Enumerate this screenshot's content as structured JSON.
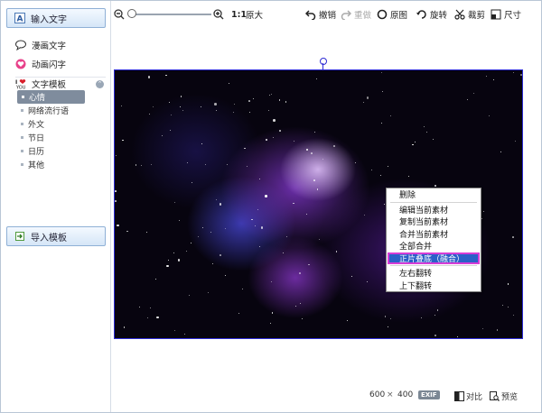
{
  "sidebar": {
    "input_text": "输入文字",
    "comic_text": "漫画文字",
    "anim_text": "动画闪字",
    "template": {
      "title": "文字模板",
      "items": [
        "心情",
        "网络流行语",
        "外文",
        "节日",
        "日历",
        "其他"
      ],
      "selected_index": 0
    },
    "import_template": "导入模板"
  },
  "toolbar": {
    "zoom_fit": "1:1",
    "original_size": "原大",
    "undo": "撤销",
    "redo": "重做",
    "original_image": "原图",
    "rotate": "旋转",
    "crop": "裁剪",
    "size": "尺寸",
    "zoom_level": 0.0
  },
  "context_menu": {
    "items": [
      {
        "label": "删除",
        "sep_after": true
      },
      {
        "label": "编辑当前素材",
        "sep_after": false
      },
      {
        "label": "复制当前素材",
        "sep_after": false
      },
      {
        "label": "合并当前素材",
        "sep_after": false
      },
      {
        "label": "全部合并",
        "sep_after": false
      },
      {
        "label": "正片叠底（融合）",
        "sep_after": true,
        "highlighted": true
      },
      {
        "label": "左右翻转",
        "sep_after": false
      },
      {
        "label": "上下翻转",
        "sep_after": false
      }
    ]
  },
  "status": {
    "width": "600",
    "times": "×",
    "height": "400",
    "exif": "EXIF",
    "compare": "对比",
    "preview": "预览"
  },
  "colors": {
    "selection_border": "#2d2bd4",
    "menu_highlight": "#2b5fc8",
    "menu_highlight_border": "#d63cd6"
  }
}
